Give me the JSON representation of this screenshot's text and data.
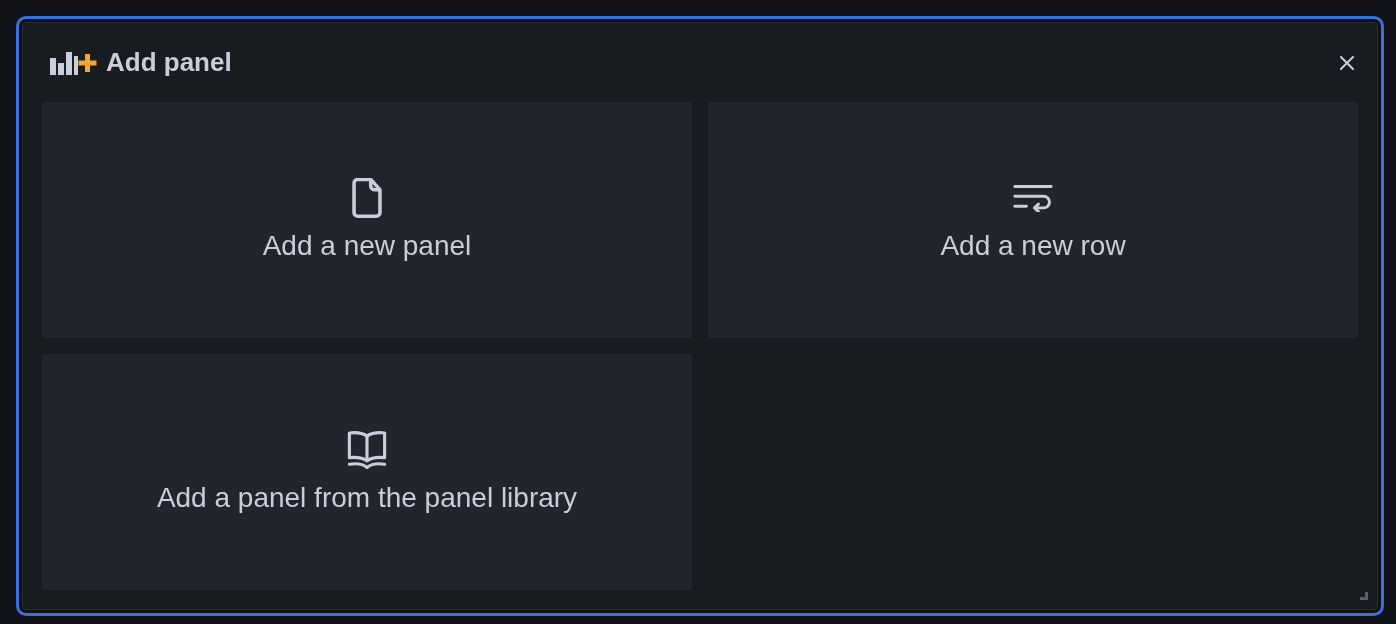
{
  "dialog": {
    "title": "Add panel",
    "focused": true
  },
  "options": [
    {
      "label": "Add a new panel",
      "kind": "panel"
    },
    {
      "label": "Add a new row",
      "kind": "row"
    },
    {
      "label": "Add a panel from the panel library",
      "kind": "library"
    }
  ]
}
